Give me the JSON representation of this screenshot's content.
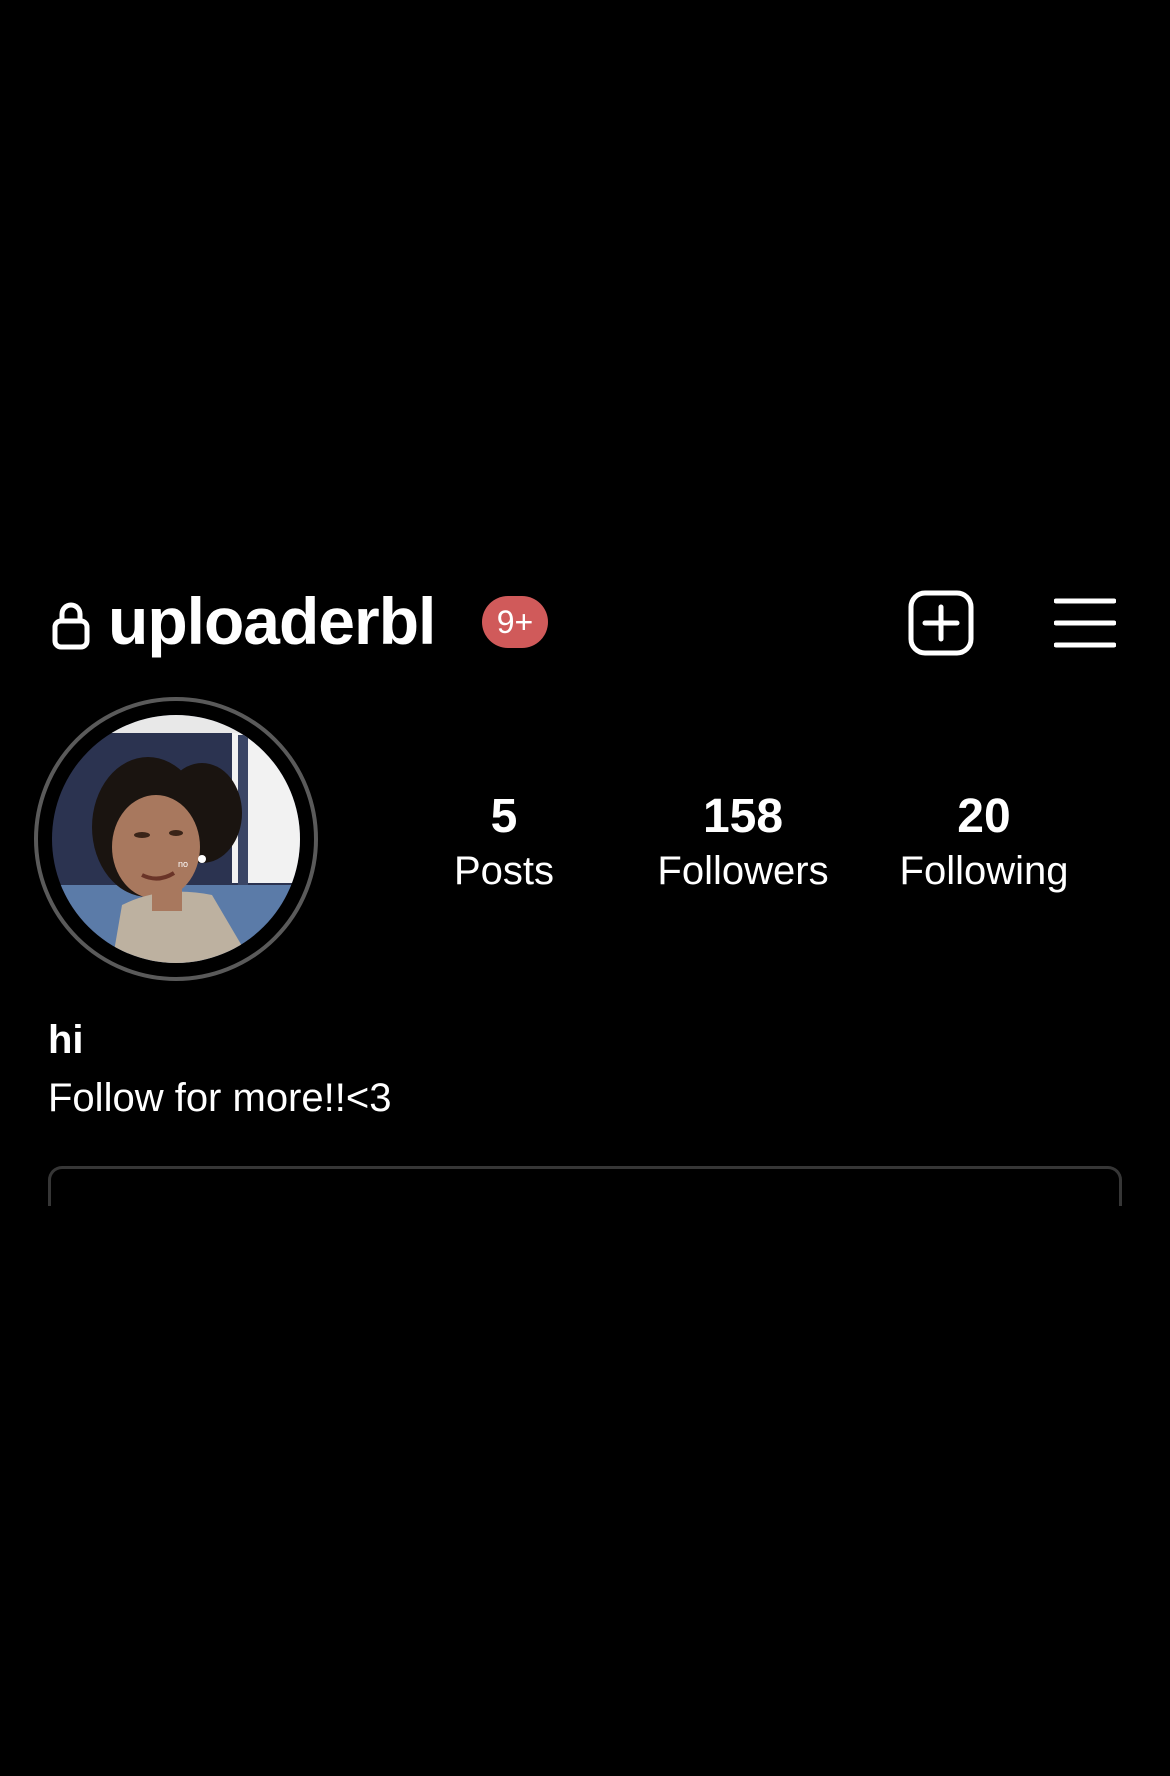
{
  "header": {
    "username": "uploaderbl",
    "notification_badge": "9+",
    "lock_icon": "lock-icon",
    "add_icon": "plus-square-icon",
    "menu_icon": "hamburger-menu-icon",
    "badge_color": "#d05a5a"
  },
  "profile": {
    "avatar_caption": "no",
    "stats": [
      {
        "value": "5",
        "label": "Posts"
      },
      {
        "value": "158",
        "label": "Followers"
      },
      {
        "value": "20",
        "label": "Following"
      }
    ]
  },
  "bio": {
    "name": "hi",
    "text": "Follow for more!!<3"
  },
  "colors": {
    "background": "#000000",
    "text": "#ffffff",
    "avatar_ring": "#5a5a5a",
    "divider": "#363636"
  }
}
